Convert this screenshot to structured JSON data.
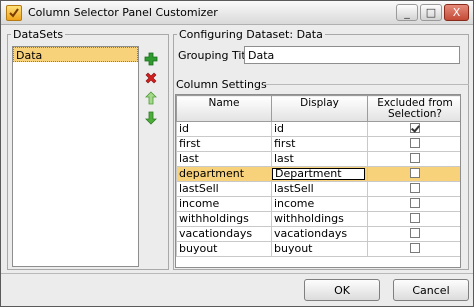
{
  "window": {
    "title": "Column Selector Panel Customizer",
    "controls": {
      "minimize": "_",
      "maximize": "□",
      "close": "X"
    }
  },
  "datasets": {
    "legend": "DataSets",
    "items": [
      "Data"
    ],
    "selected": "Data",
    "buttons": [
      "add-icon",
      "delete-icon",
      "move-up-icon",
      "move-down-icon"
    ]
  },
  "config": {
    "legend": "Configuring Dataset: Data",
    "grouping_title_label": "Grouping Title",
    "grouping_title_value": "Data",
    "column_settings_label": "Column Settings",
    "columns": [
      "Name",
      "Display",
      "Excluded from Selection?"
    ],
    "rows": [
      {
        "name": "id",
        "display": "id",
        "excluded": true
      },
      {
        "name": "first",
        "display": "first",
        "excluded": false
      },
      {
        "name": "last",
        "display": "last",
        "excluded": false
      },
      {
        "name": "department",
        "display": "Department",
        "excluded": false
      },
      {
        "name": "lastSell",
        "display": "lastSell",
        "excluded": false
      },
      {
        "name": "income",
        "display": "income",
        "excluded": false
      },
      {
        "name": "withholdings",
        "display": "withholdings",
        "excluded": false
      },
      {
        "name": "vacationdays",
        "display": "vacationdays",
        "excluded": false
      },
      {
        "name": "buyout",
        "display": "buyout",
        "excluded": false
      }
    ]
  },
  "footer": {
    "ok_label": "OK",
    "cancel_label": "Cancel"
  },
  "colors": {
    "selection": "#f8d27b",
    "add": "#2e9b2e",
    "delete": "#d22020",
    "move": "#4caf3a"
  }
}
